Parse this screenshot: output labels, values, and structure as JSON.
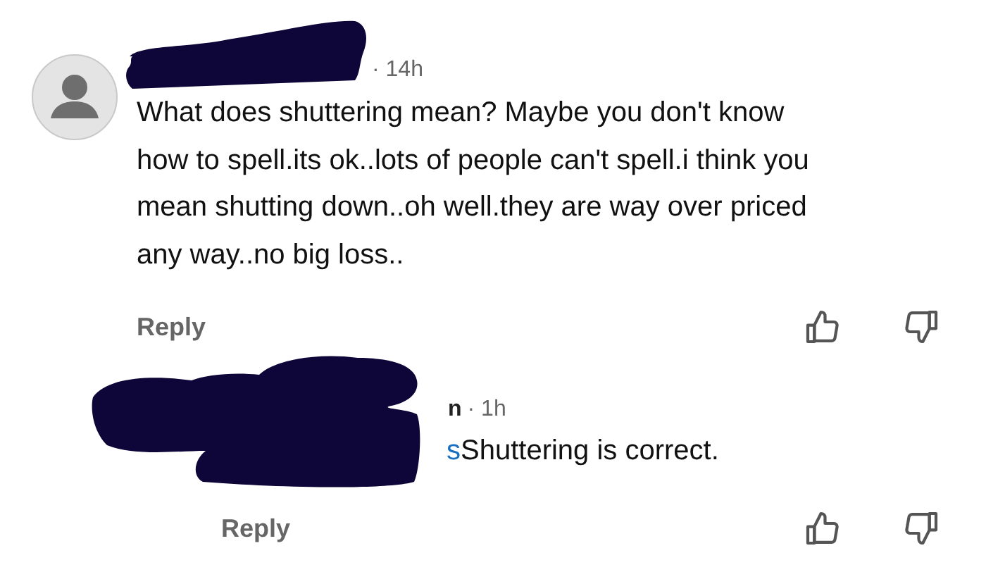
{
  "comments": [
    {
      "kind": "top",
      "time": "· 14h",
      "body": "What does shuttering mean? Maybe you don't know how to spell.its ok..lots of people can't spell.i think you mean shutting down..oh well.they are way over priced any way..no big loss..",
      "reply_label": "Reply"
    },
    {
      "kind": "reply",
      "name_fragment": "n",
      "time": "· 1h",
      "mention_fragment": "s",
      "body": "Shuttering is correct.",
      "reply_label": "Reply"
    }
  ]
}
